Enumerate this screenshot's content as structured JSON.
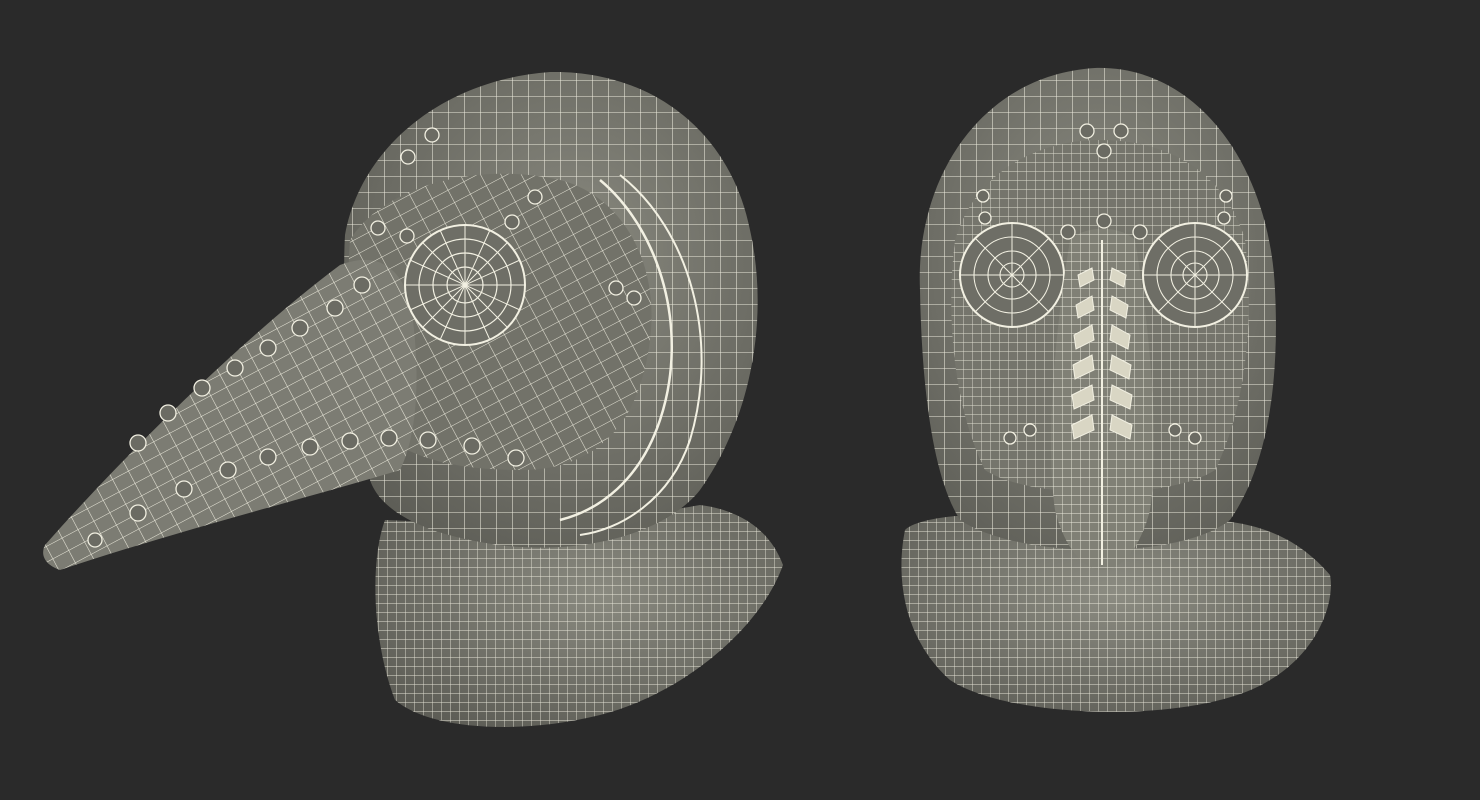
{
  "scene": {
    "background_color": "#2a2a2a",
    "mesh_fill_color": "#7a7a70",
    "mesh_fill_dark": "#5f5f57",
    "wire_color": "#f2f0e2",
    "models": [
      {
        "view": "side",
        "description_icon": "plague-doctor-mask-side-icon"
      },
      {
        "view": "front",
        "description_icon": "plague-doctor-mask-front-icon"
      }
    ]
  }
}
